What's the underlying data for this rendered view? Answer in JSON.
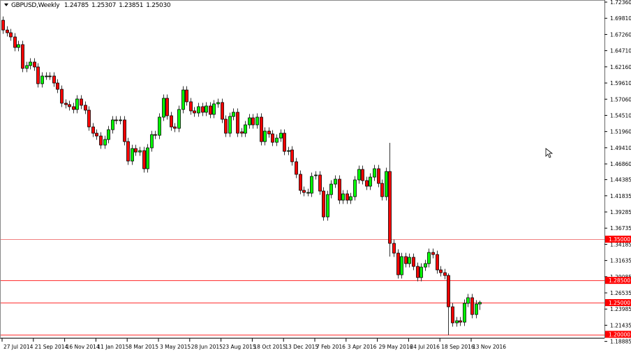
{
  "header": {
    "symbol": "GBPUSD,Weekly",
    "open": "1.24785",
    "high": "1.25307",
    "low": "1.23851",
    "close": "1.25030"
  },
  "colors": {
    "bull": "#00ff00",
    "bear": "#ff0000",
    "level_line": "#ff3030",
    "level_label_bg": "#ff0000"
  },
  "chart_data": {
    "type": "candlestick",
    "title": "GBPUSD,Weekly",
    "ylim": [
      1.18885,
      1.7236
    ],
    "y_ticks": [
      "1.72360",
      "1.69810",
      "1.67260",
      "1.64710",
      "1.62160",
      "1.59610",
      "1.57060",
      "1.54510",
      "1.51960",
      "1.49410",
      "1.46860",
      "1.44385",
      "1.41835",
      "1.39285",
      "1.36735",
      "1.34185",
      "1.31635",
      "1.29085",
      "1.26535",
      "1.23985",
      "1.21435",
      "1.18885"
    ],
    "x_labels": [
      {
        "label": "27 Jul 2014",
        "week": 0
      },
      {
        "label": "21 Sep 2014",
        "week": 8
      },
      {
        "label": "16 Nov 2014",
        "week": 16
      },
      {
        "label": "11 Jan 2015",
        "week": 24
      },
      {
        "label": "8 Mar 2015",
        "week": 32
      },
      {
        "label": "3 May 2015",
        "week": 40
      },
      {
        "label": "28 Jun 2015",
        "week": 48
      },
      {
        "label": "23 Aug 2015",
        "week": 56
      },
      {
        "label": "18 Oct 2015",
        "week": 64
      },
      {
        "label": "13 Dec 2015",
        "week": 72
      },
      {
        "label": "7 Feb 2016",
        "week": 80
      },
      {
        "label": "3 Apr 2016",
        "week": 88
      },
      {
        "label": "29 May 2016",
        "week": 96
      },
      {
        "label": "24 Jul 2016",
        "week": 104
      },
      {
        "label": "18 Sep 2016",
        "week": 112
      },
      {
        "label": "13 Nov 2016",
        "week": 120
      }
    ],
    "levels": [
      {
        "value": "1.35000",
        "price": 1.35
      },
      {
        "value": "1.28500",
        "price": 1.285
      },
      {
        "value": "1.25000",
        "price": 1.25
      },
      {
        "value": "1.20000",
        "price": 1.2
      }
    ],
    "candles_open_close": [
      [
        1.695,
        1.6796
      ],
      [
        1.6796,
        1.6753
      ],
      [
        1.6753,
        1.6687
      ],
      [
        1.6687,
        1.6522
      ],
      [
        1.6522,
        1.6566
      ],
      [
        1.6566,
        1.6192
      ],
      [
        1.6192,
        1.6236
      ],
      [
        1.6236,
        1.6291
      ],
      [
        1.6291,
        1.6214
      ],
      [
        1.6214,
        1.595
      ],
      [
        1.595,
        1.6071
      ],
      [
        1.6071,
        1.6071
      ],
      [
        1.6071,
        1.607
      ],
      [
        1.6071,
        1.5961
      ],
      [
        1.5961,
        1.5862
      ],
      [
        1.5862,
        1.5643
      ],
      [
        1.5643,
        1.5621
      ],
      [
        1.5621,
        1.5588
      ],
      [
        1.5588,
        1.5544
      ],
      [
        1.5544,
        1.5709
      ],
      [
        1.5709,
        1.561
      ],
      [
        1.561,
        1.5533
      ],
      [
        1.5533,
        1.5269
      ],
      [
        1.5269,
        1.517
      ],
      [
        1.517,
        1.5126
      ],
      [
        1.5126,
        1.4983
      ],
      [
        1.4983,
        1.5071
      ],
      [
        1.5071,
        1.5225
      ],
      [
        1.5225,
        1.5379
      ],
      [
        1.5379,
        1.537
      ],
      [
        1.537,
        1.5379
      ],
      [
        1.5379,
        1.5038
      ],
      [
        1.5038,
        1.4731
      ],
      [
        1.4731,
        1.4928
      ],
      [
        1.4928,
        1.4873
      ],
      [
        1.4873,
        1.4895
      ],
      [
        1.4895,
        1.461
      ],
      [
        1.461,
        1.4939
      ],
      [
        1.4939,
        1.5148
      ],
      [
        1.5148,
        1.5137
      ],
      [
        1.5137,
        1.5423
      ],
      [
        1.5423,
        1.572
      ],
      [
        1.572,
        1.5445
      ],
      [
        1.5445,
        1.5269
      ],
      [
        1.5269,
        1.5247
      ],
      [
        1.5247,
        1.5544
      ],
      [
        1.5544,
        1.5851
      ],
      [
        1.5851,
        1.5665
      ],
      [
        1.5665,
        1.5522
      ],
      [
        1.5522,
        1.5489
      ],
      [
        1.5489,
        1.5588
      ],
      [
        1.5588,
        1.55
      ],
      [
        1.55,
        1.5599
      ],
      [
        1.5599,
        1.5467
      ],
      [
        1.5467,
        1.5632
      ],
      [
        1.5632,
        1.5654
      ],
      [
        1.5654,
        1.539
      ],
      [
        1.539,
        1.517
      ],
      [
        1.517,
        1.5434
      ],
      [
        1.5434,
        1.55
      ],
      [
        1.55,
        1.517
      ],
      [
        1.5192,
        1.517
      ],
      [
        1.517,
        1.5302
      ],
      [
        1.5302,
        1.5412
      ],
      [
        1.5412,
        1.5302
      ],
      [
        1.5302,
        1.5423
      ],
      [
        1.5423,
        1.5038
      ],
      [
        1.5038,
        1.5203
      ],
      [
        1.5203,
        1.5159
      ],
      [
        1.5159,
        1.5027
      ],
      [
        1.5027,
        1.5093
      ],
      [
        1.5093,
        1.517
      ],
      [
        1.517,
        1.4884
      ],
      [
        1.4884,
        1.4895
      ],
      [
        1.4906,
        1.472
      ],
      [
        1.472,
        1.4522
      ],
      [
        1.4522,
        1.4269
      ],
      [
        1.4269,
        1.4236
      ],
      [
        1.4236,
        1.4236
      ],
      [
        1.4225,
        1.4489
      ],
      [
        1.45,
        1.4511
      ],
      [
        1.4511,
        1.4258
      ],
      [
        1.4258,
        1.3851
      ],
      [
        1.3851,
        1.4203
      ],
      [
        1.4203,
        1.4368
      ],
      [
        1.4368,
        1.4445
      ],
      [
        1.4445,
        1.4115
      ],
      [
        1.4115,
        1.4214
      ],
      [
        1.4214,
        1.4115
      ],
      [
        1.4115,
        1.417
      ],
      [
        1.417,
        1.4434
      ],
      [
        1.4434,
        1.4599
      ],
      [
        1.4599,
        1.4423
      ],
      [
        1.4423,
        1.4335
      ],
      [
        1.4335,
        1.4478
      ],
      [
        1.4478,
        1.461
      ],
      [
        1.461,
        1.4379
      ],
      [
        1.4379,
        1.417
      ],
      [
        1.417,
        1.4566
      ],
      [
        1.4566,
        1.3434
      ],
      [
        1.3434,
        1.328
      ],
      [
        1.328,
        1.2939
      ],
      [
        1.2939,
        1.3225
      ],
      [
        1.3225,
        1.3115
      ],
      [
        1.3115,
        1.3214
      ],
      [
        1.3214,
        1.3071
      ],
      [
        1.3071,
        1.2895
      ],
      [
        1.2895,
        1.306
      ],
      [
        1.306,
        1.3115
      ],
      [
        1.3115,
        1.3291
      ],
      [
        1.3291,
        1.3258
      ],
      [
        1.3258,
        1.3016
      ],
      [
        1.3016,
        1.2972
      ],
      [
        1.2972,
        1.2928
      ],
      [
        1.2928,
        1.2434
      ],
      [
        1.2434,
        1.2181
      ],
      [
        1.2181,
        1.2214
      ],
      [
        1.2214,
        1.2192
      ],
      [
        1.2192,
        1.2489
      ],
      [
        1.2489,
        1.2577
      ],
      [
        1.2577,
        1.2313
      ],
      [
        1.2313,
        1.2478
      ],
      [
        1.24785,
        1.2503
      ]
    ],
    "wick_extremes": {
      "99": [
        1.5018,
        1.3225
      ],
      "114": [
        1.296,
        1.1986
      ],
      "122": [
        1.25307,
        1.23851
      ]
    },
    "default_wick": 0.006
  }
}
